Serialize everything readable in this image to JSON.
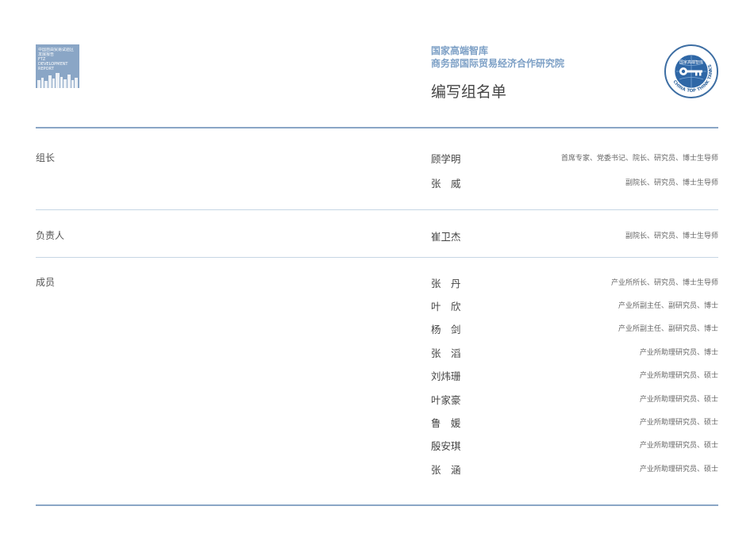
{
  "logo": {
    "lines": [
      "中国自由贸易试验区",
      "发展报告",
      "FTZ",
      "DEVELOPMENT",
      "REPORT"
    ]
  },
  "header": {
    "org_line1": "国家高端智库",
    "org_line2": "商务部国际贸易经济合作研究院",
    "title": "编写组名单"
  },
  "seal": {
    "top_text": "国家高端智库",
    "ring_text": "CHINA TOP THINK TANKS"
  },
  "sections": [
    {
      "label": "组长",
      "members": [
        {
          "name": "顾学明",
          "title": "首席专家、党委书记、院长、研究员、博士生导师"
        },
        {
          "name": "张　威",
          "title": "副院长、研究员、博士生导师"
        }
      ]
    },
    {
      "label": "负责人",
      "members": [
        {
          "name": "崔卫杰",
          "title": "副院长、研究员、博士生导师"
        }
      ]
    },
    {
      "label": "成员",
      "members": [
        {
          "name": "张　丹",
          "title": "产业所所长、研究员、博士生导师"
        },
        {
          "name": "叶　欣",
          "title": "产业所副主任、副研究员、博士"
        },
        {
          "name": "杨　剑",
          "title": "产业所副主任、副研究员、博士"
        },
        {
          "name": "张　滔",
          "title": "产业所助理研究员、博士"
        },
        {
          "name": "刘炜珊",
          "title": "产业所助理研究员、硕士"
        },
        {
          "name": "叶家豪",
          "title": "产业所助理研究员、硕士"
        },
        {
          "name": "鲁　媛",
          "title": "产业所助理研究员、硕士"
        },
        {
          "name": "殷安琪",
          "title": "产业所助理研究员、硕士"
        },
        {
          "name": "张　涵",
          "title": "产业所助理研究员、硕士"
        }
      ]
    }
  ],
  "colors": {
    "accent": "#8aa6c6",
    "accent_text": "#7da0c6",
    "rule_light": "#c6d6e4"
  }
}
